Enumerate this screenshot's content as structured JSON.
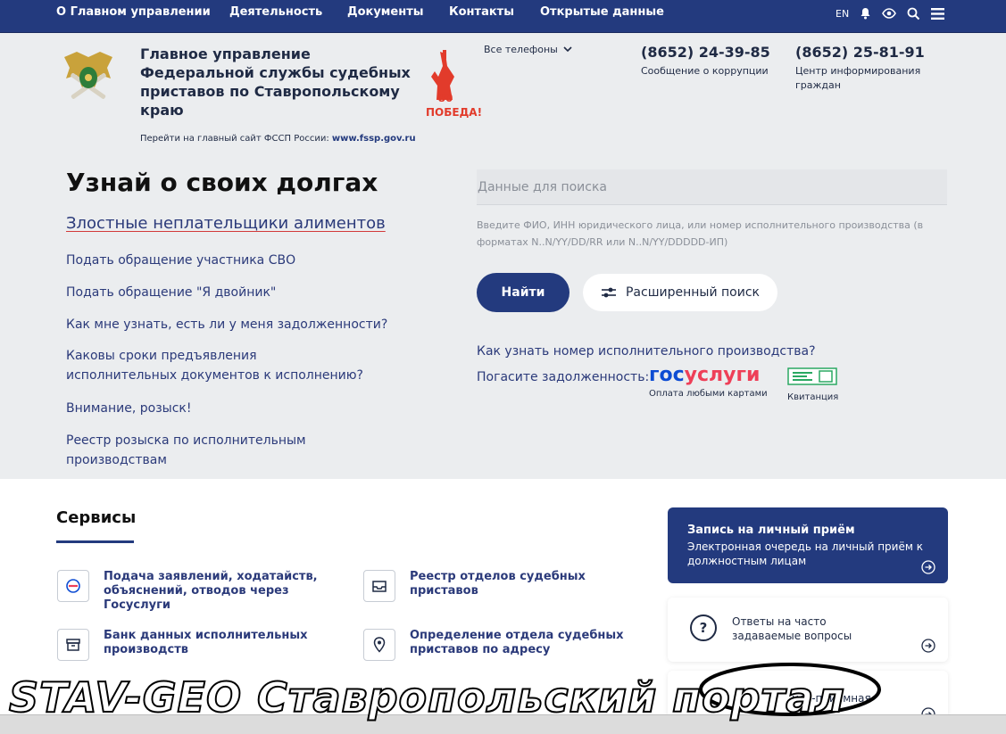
{
  "topnav": {
    "items": [
      "О Главном управлении",
      "Деятельность",
      "Документы",
      "Контакты",
      "Открытые данные"
    ],
    "lang": "EN",
    "icons": [
      "bell-icon",
      "eye-icon",
      "search-icon",
      "menu-icon"
    ]
  },
  "header": {
    "org_name": "Главное управление Федеральной службы судебных приставов по Ставропольскому краю",
    "fssp_link_text": "Перейти на главный сайт ФССП России:",
    "fssp_link_url_text": "www.fssp.gov.ru",
    "phones_all": "Все телефоны",
    "phone1": {
      "number": "(8652) 24-39-85",
      "caption": "Сообщение о коррупции"
    },
    "phone2": {
      "number": "(8652) 25-81-91",
      "caption": "Центр информирования граждан"
    },
    "victory_badge": "80 ПОБЕДА!"
  },
  "hero": {
    "title": "Узнай о своих долгах",
    "malicious_link": "Злостные неплательщики алиментов",
    "links": [
      "Подать обращение участника СВО",
      "Подать обращение \"Я двойник\"",
      "Как мне узнать, есть ли у меня задолженности?",
      "Каковы сроки предъявления исполнительных документов к исполнению?",
      "Внимание, розыск!",
      "Реестр розыска по исполнительным производствам"
    ]
  },
  "search": {
    "placeholder": "Данные для поиска",
    "hint": "Введите ФИО, ИНН юридического лица, или номер исполнительного производства (в форматах N..N/YY/DD/RR или N..N/YY/DDDDD-ИП)",
    "find_label": "Найти",
    "advanced_label": "Расширенный поиск",
    "how_to_know": "Как узнать номер исполнительного производства?",
    "pay_label": "Погасите задолженность:",
    "gosuslugi_logo_part1": "гос",
    "gosuslugi_logo_part2": "услуги",
    "gosuslugi_caption": "Оплата любыми картами",
    "receipt_caption": "Квитанция"
  },
  "services": {
    "title": "Сервисы",
    "items": [
      "Подача заявлений, ходатайств, объяснений, отводов через Госуслуги",
      "Реестр отделов судебных приставов",
      "Банк данных исполнительных производств",
      "Определение отдела судебных приставов по адресу"
    ]
  },
  "cards": {
    "appointment_title": "Запись на личный приём",
    "appointment_desc": "Электронная очередь на личный приём к должностным лицам",
    "faq": "Ответы на часто задаваемые вопросы",
    "internet_reception": "нет-приёмная"
  },
  "watermark": "STAV-GEO Ставропольский портал",
  "colors": {
    "primary": "#233a7e",
    "hero_bg": "#ebedef",
    "gos_blue": "#0d4cd3",
    "gos_red": "#ee3f58",
    "underline_red": "#d23a3a"
  }
}
